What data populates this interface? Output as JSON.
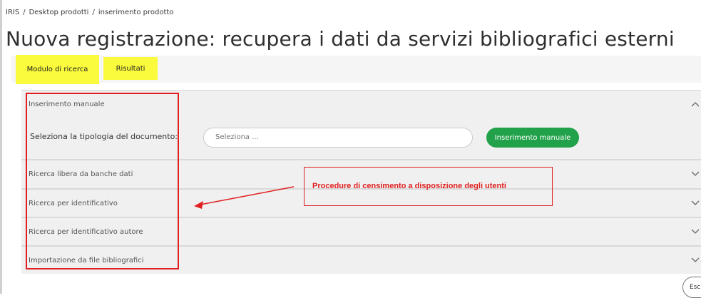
{
  "breadcrumb": {
    "items": [
      "IRIS",
      "Desktop prodotti",
      "inserimento prodotto"
    ],
    "separator": "/"
  },
  "page": {
    "title": "Nuova registrazione: recupera i dati da servizi bibliografici esterni"
  },
  "tabs": [
    {
      "label": "Modulo di ricerca"
    },
    {
      "label": "Risultati"
    }
  ],
  "accordion": {
    "sections": [
      {
        "label": "Inserimento manuale",
        "expanded": true
      },
      {
        "label": "Ricerca libera da banche dati",
        "expanded": false
      },
      {
        "label": "Ricerca per identificativo",
        "expanded": false
      },
      {
        "label": "Ricerca per identificativo autore",
        "expanded": false
      },
      {
        "label": "Importazione da file bibliografici",
        "expanded": false
      }
    ],
    "manual": {
      "doc_type_label": "Seleziona la tipologia del documento:",
      "select_placeholder": "Seleziona ...",
      "button_label": "Inserimento manuale"
    }
  },
  "annotation": {
    "text": "Procedure di censimento a disposizione degli utenti",
    "color": "#e02020"
  },
  "esc_button": {
    "label": "Esc"
  },
  "colors": {
    "tab_highlight": "#fbfb3d",
    "primary_button": "#21a14a",
    "annotation": "#e02020"
  },
  "icons": {
    "expanded": "chevron-up-icon",
    "collapsed": "chevron-down-icon"
  }
}
